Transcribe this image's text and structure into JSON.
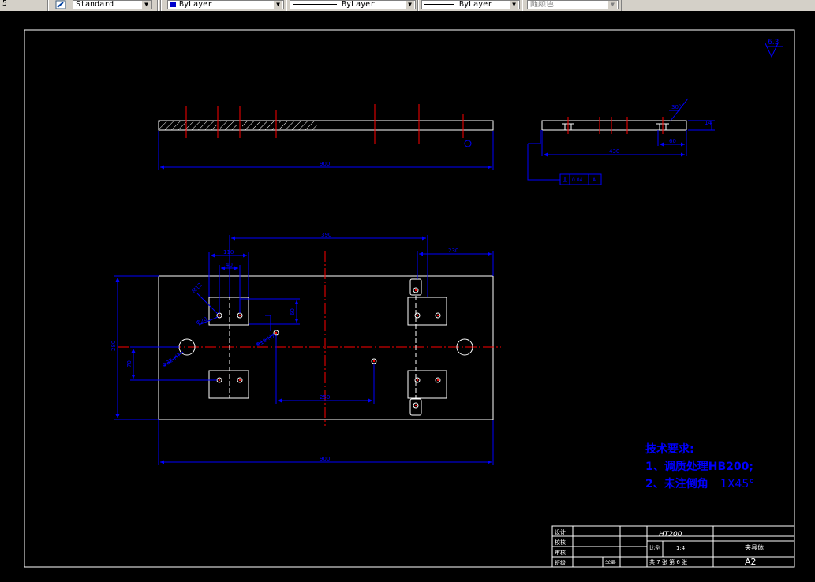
{
  "toolbar": {
    "left_fragment": "5",
    "text_style": "Standard",
    "layer": "ByLayer",
    "linetype": "ByLayer",
    "lineweight": "ByLayer",
    "plot_color": "随颜色",
    "layer_color": "#0000cc"
  },
  "drawing": {
    "roughness": "6.3",
    "tech_title": "技术要求:",
    "tech_line1": "1、调质处理HB200;",
    "tech_line2_prefix": "2、未注倒角",
    "tech_line2_value": "1X45°",
    "dims": {
      "side_len": "900",
      "side_sec_right": "430",
      "side_sec_small": "60",
      "side_sec_angle": "30°",
      "side_sec_thk": "14",
      "datum_box": "0.04",
      "datum_letter": "A",
      "plan_top": "390",
      "plan_right_top": "230",
      "plan_left_top": "110",
      "plan_left_small": "40",
      "plan_height": "280",
      "plan_left_mid": "70",
      "plan_right_mid": "60",
      "plan_bottom_mid": "250",
      "plan_bottom_total": "900",
      "hole_note1": "M12",
      "hole_note2": "Φ20",
      "hole_note3": "Φ32-H7",
      "hole_note4": "Φ16-H7"
    },
    "colors": {
      "outline": "#ffffff",
      "dimension": "#0000ff",
      "centerline": "#ff0000",
      "text": "#0000ff"
    }
  },
  "title_block": {
    "material": "HT200",
    "scale_label": "比例",
    "scale": "1:4",
    "sheet": "共 7 张 第 6 张",
    "part_name": "夹具体",
    "size": "A2",
    "r1": "设计",
    "r2": "校核",
    "r3": "审核",
    "r4": "班级",
    "r4b": "学号"
  }
}
